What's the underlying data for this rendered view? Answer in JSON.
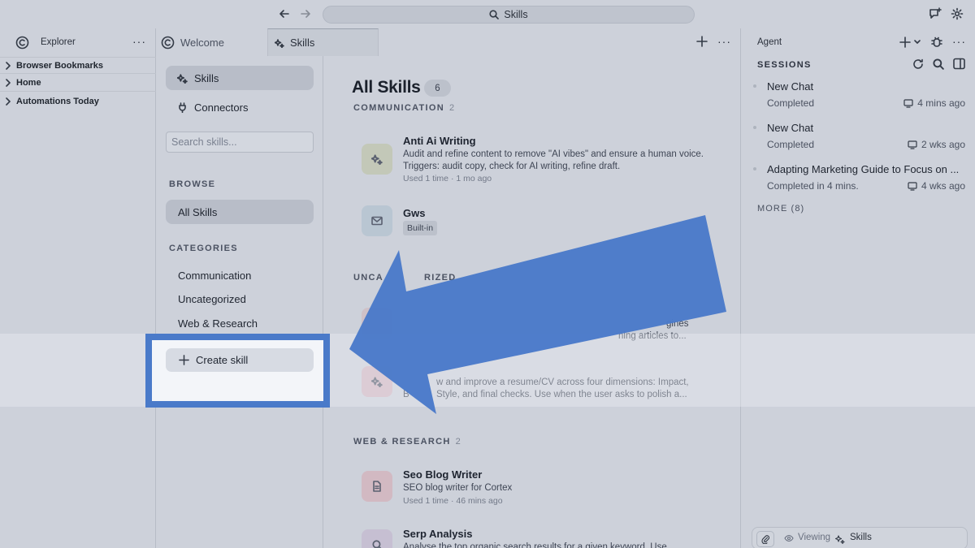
{
  "search": {
    "label": "Skills"
  },
  "explorer": {
    "title": "Explorer",
    "items": [
      {
        "label": "Browser Bookmarks"
      },
      {
        "label": "Home"
      },
      {
        "label": "Automations Today"
      }
    ]
  },
  "tabs": [
    {
      "label": "Welcome",
      "active": false
    },
    {
      "label": "Skills",
      "active": true
    }
  ],
  "skills_nav": {
    "items": [
      {
        "label": "Skills"
      },
      {
        "label": "Connectors"
      }
    ],
    "search_placeholder": "Search skills...",
    "browse_heading": "BROWSE",
    "browse_item": "All Skills",
    "categories_heading": "CATEGORIES",
    "categories": [
      "Communication",
      "Uncategorized",
      "Web & Research"
    ],
    "create_label": "Create skill"
  },
  "main": {
    "title": "All Skills",
    "count": "6",
    "groups": [
      {
        "name": "COMMUNICATION",
        "count": "2",
        "skills": [
          {
            "name": "Anti Ai Writing",
            "description": "Audit and refine content to remove \"AI vibes\" and ensure a human voice. Triggers: audit copy, check for AI writing, refine draft.",
            "meta": "Used 1 time · 1 mo ago",
            "icon": "sparkle-icon"
          },
          {
            "name": "Gws",
            "badge": "Built-in",
            "icon": "mail-icon"
          }
        ]
      },
      {
        "name": "UNCATEGORIZED",
        "partial_label": "UNCA",
        "partial_label_2": "RIZED",
        "fragments": [
          "gines",
          "ning articles to..."
        ],
        "skills": [
          {
            "description_line1": "w and improve a resume/CV across four dimensions: Impact,",
            "description_line2_a": "B",
            "description_line2_b": "Style, and final checks. Use when the user asks to polish a...",
            "icon": "sparkle-icon"
          }
        ]
      },
      {
        "name": "WEB & RESEARCH",
        "count": "2",
        "skills": [
          {
            "name": "Seo Blog Writer",
            "description": "SEO blog writer for Cortex",
            "meta": "Used 1 time · 46 mins ago",
            "icon": "document-icon"
          },
          {
            "name": "Serp Analysis",
            "description": "Analyse the top organic search results for a given keyword. Use",
            "icon": "search-icon"
          }
        ]
      }
    ]
  },
  "agent": {
    "title": "Agent",
    "sessions_heading": "SESSIONS",
    "sessions": [
      {
        "title": "New Chat",
        "status": "Completed",
        "time": "4 mins ago"
      },
      {
        "title": "New Chat",
        "status": "Completed",
        "time": "2 wks ago"
      },
      {
        "title": "Adapting Marketing Guide to Focus on ...",
        "status": "Completed in 4 mins.",
        "time": "4 wks ago"
      }
    ],
    "more_label": "MORE (8)",
    "viewing_label": "Viewing",
    "viewing_target": "Skills"
  },
  "colors": {
    "highlight": "#4a7ac9",
    "arrow": "#4a7ac9"
  }
}
